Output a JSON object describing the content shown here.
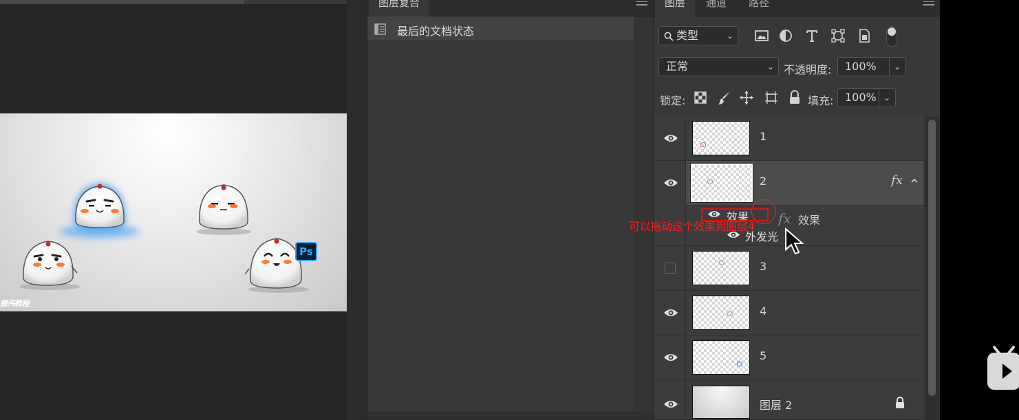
{
  "history_panel": {
    "tab": "图层复合",
    "items": [
      {
        "label": "最后的文档状态",
        "icon": "snapshot-icon"
      }
    ]
  },
  "layers_panel": {
    "tabs": [
      "图层",
      "通道",
      "路径"
    ],
    "filter": {
      "label": "类型",
      "icon": "search-icon"
    },
    "blend_mode": "正常",
    "opacity_label": "不透明度:",
    "opacity_value": "100%",
    "lock_label": "锁定:",
    "fill_label": "填充:",
    "fill_value": "100%",
    "layers": [
      {
        "name": "1",
        "visible": true
      },
      {
        "name": "2",
        "visible": true,
        "selected": true,
        "fx": "fx"
      },
      {
        "name": "3",
        "visible": false
      },
      {
        "name": "4",
        "visible": true
      },
      {
        "name": "5",
        "visible": true
      },
      {
        "name": "图层 2",
        "visible": true,
        "locked": true
      }
    ],
    "effects": {
      "group_label": "效果",
      "items": [
        {
          "label": "外发光"
        }
      ]
    }
  },
  "overlay": {
    "annotation": "可以拖动这个效果到图层4",
    "ghost_fx": "fx",
    "ghost_label": "效果"
  },
  "canvas": {
    "watermark": "振伟教程",
    "badge": "Ps"
  },
  "colors": {
    "annotation": "#ff1a1a",
    "glow": "#3a9bf5",
    "ps_badge": "#31a8ff"
  }
}
